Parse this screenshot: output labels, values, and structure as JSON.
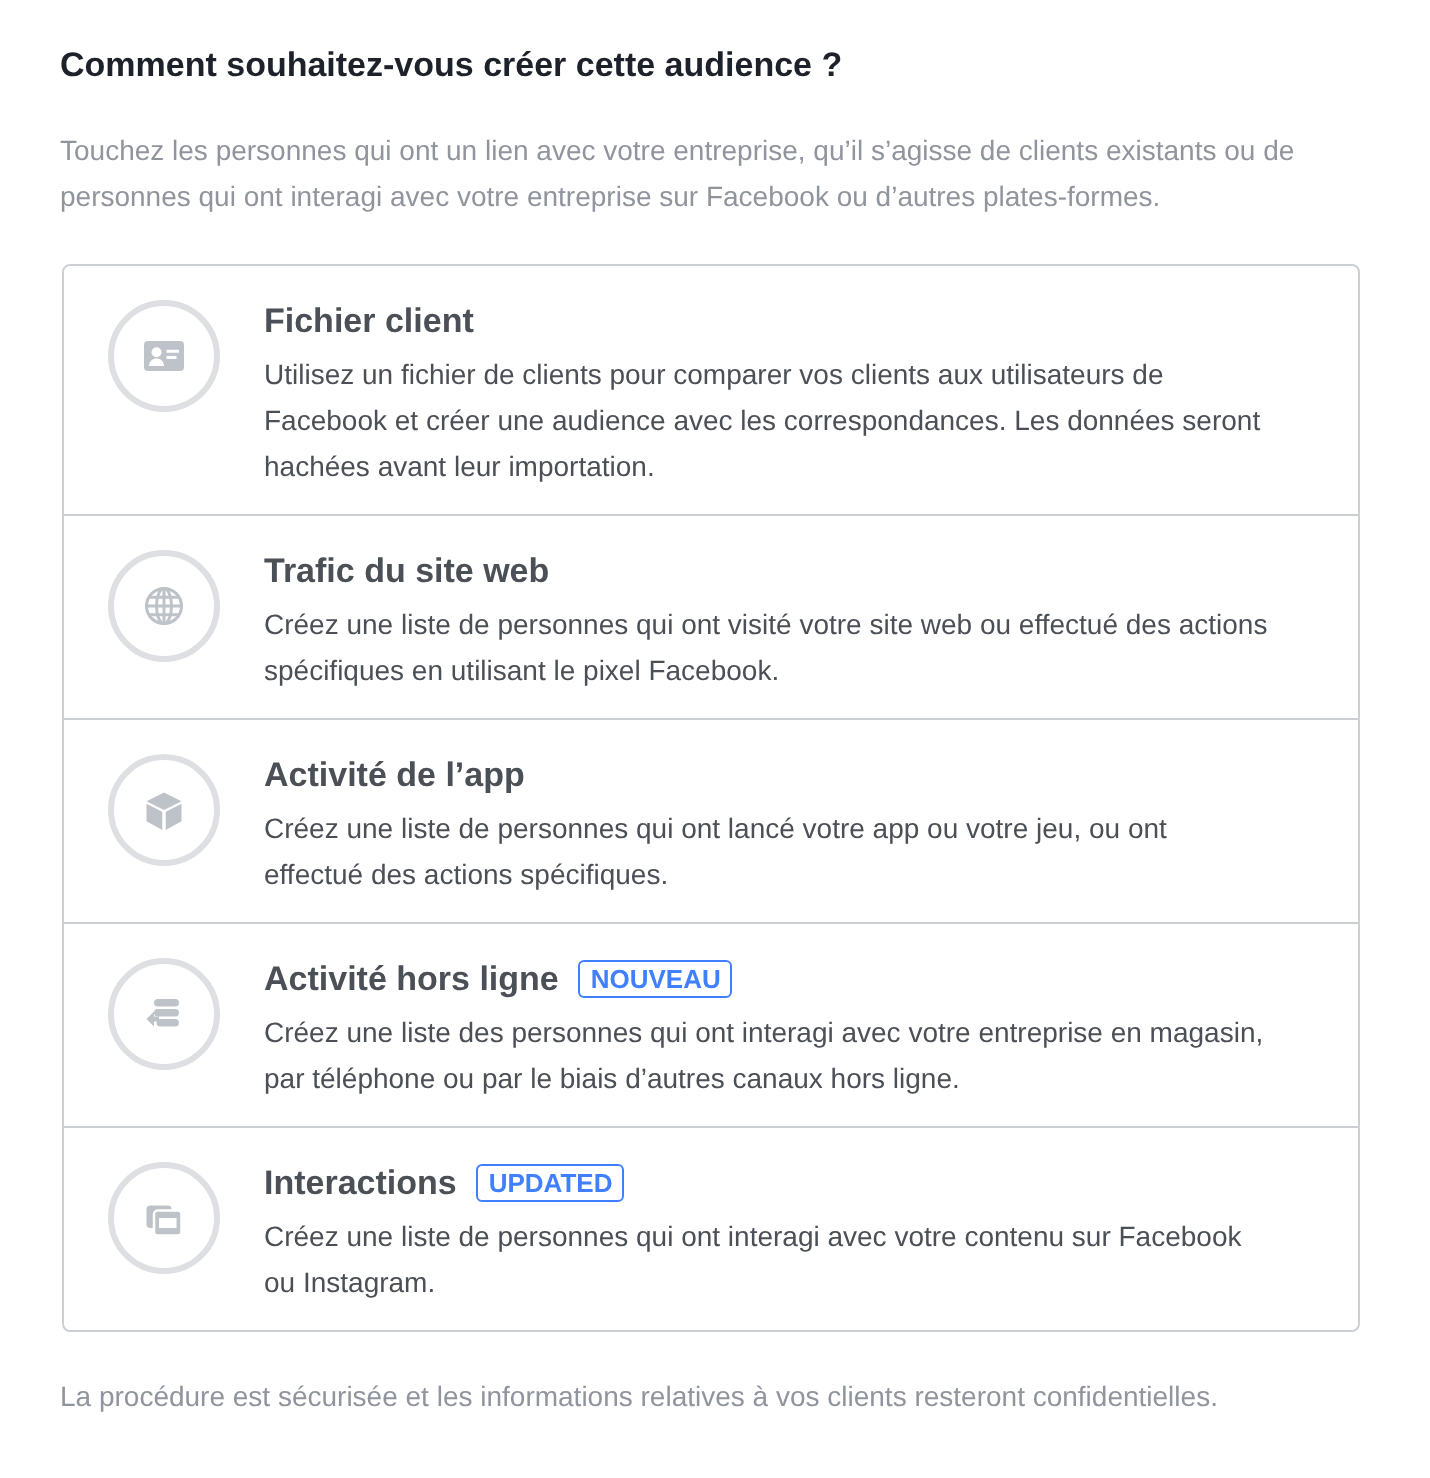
{
  "heading": "Comment souhaitez-vous créer cette audience ?",
  "intro": "Touchez les personnes qui ont un lien avec votre entreprise, qu’il s’agisse de clients existants ou de personnes qui ont interagi avec votre entreprise sur Facebook ou d’autres plates-formes.",
  "options": [
    {
      "kind": "contact-card",
      "title": "Fichier client",
      "description": "Utilisez un fichier de clients pour comparer vos clients aux utilisateurs de Facebook et créer une audience avec les correspondances. Les données seront hachées avant leur importation."
    },
    {
      "kind": "globe",
      "title": "Trafic du site web",
      "description": "Créez une liste de personnes qui ont visité votre site web ou effectué des actions spécifiques en utilisant le pixel Facebook."
    },
    {
      "kind": "cube",
      "title": "Activité de l’app",
      "description": "Créez une liste de personnes qui ont lancé votre app ou votre jeu, ou ont effectué des actions spécifiques."
    },
    {
      "kind": "sync",
      "title": "Activité hors ligne",
      "badge": "NOUVEAU",
      "description": "Créez une liste des personnes qui ont interagi avec votre entreprise en magasin, par téléphone ou par le biais d’autres canaux hors ligne."
    },
    {
      "kind": "stack",
      "title": "Interactions",
      "badge": "UPDATED",
      "description": "Créez une liste de personnes qui ont interagi avec votre contenu sur Facebook ou Instagram."
    }
  ],
  "footer": "La procédure est sécurisée et les informations relatives à vos clients resteront confidentielles."
}
